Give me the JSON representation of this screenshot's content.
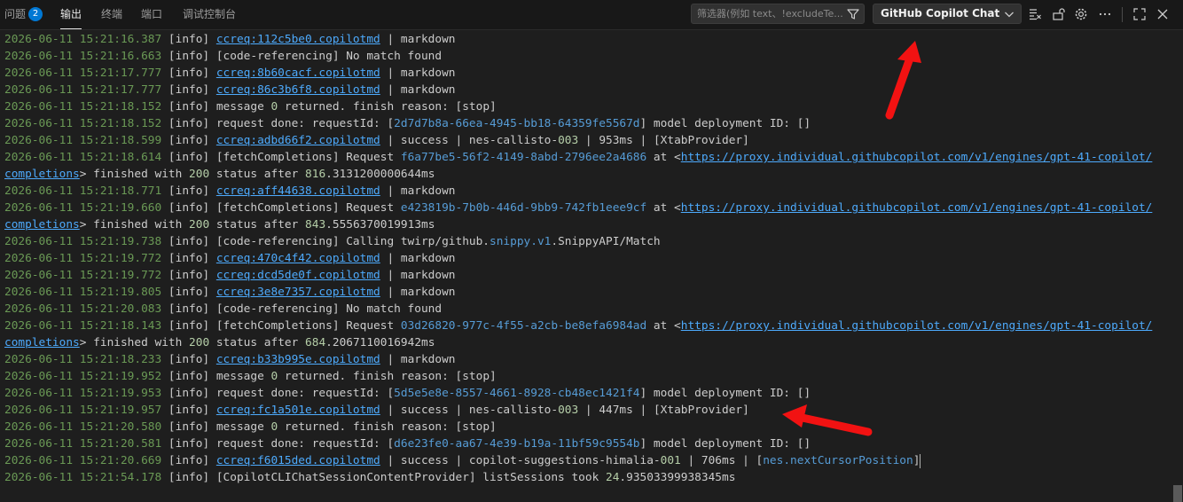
{
  "tabs": [
    {
      "label": "问题",
      "badge": "2"
    },
    {
      "label": "输出"
    },
    {
      "label": "终端"
    },
    {
      "label": "端口"
    },
    {
      "label": "调试控制台"
    }
  ],
  "filter": {
    "placeholder": "筛选器(例如 text、!excludeTe..."
  },
  "channel": {
    "selected": "GitHub Copilot Chat"
  },
  "toolbar_icons": [
    "filter-icon",
    "chevron-down-icon",
    "clear-output-icon",
    "lock-icon",
    "gear-icon",
    "more-icon",
    "maximize-icon",
    "close-icon"
  ],
  "colors": {
    "timestamp": "#6a9955",
    "number": "#b5cea8",
    "hash": "#569cd6",
    "link": "#4daafc",
    "arrow": "#f21212"
  },
  "log": [
    [
      [
        "ts",
        "2026-06-11 15:21:16.387"
      ],
      [
        "t",
        " [info] "
      ],
      [
        "lnk",
        "ccreq:112c5be0.copilotmd"
      ],
      [
        "t",
        " | markdown"
      ]
    ],
    [
      [
        "ts",
        "2026-06-11 15:21:16.663"
      ],
      [
        "t",
        " [info] [code-referencing] No match found"
      ]
    ],
    [
      [
        "ts",
        "2026-06-11 15:21:17.777"
      ],
      [
        "t",
        " [info] "
      ],
      [
        "lnk",
        "ccreq:8b60cacf.copilotmd"
      ],
      [
        "t",
        " | markdown"
      ]
    ],
    [
      [
        "ts",
        "2026-06-11 15:21:17.777"
      ],
      [
        "t",
        " [info] "
      ],
      [
        "lnk",
        "ccreq:86c3b6f8.copilotmd"
      ],
      [
        "t",
        " | markdown"
      ]
    ],
    [
      [
        "ts",
        "2026-06-11 15:21:18.152"
      ],
      [
        "t",
        " [info] message "
      ],
      [
        "num",
        "0"
      ],
      [
        "t",
        " returned. finish reason: [stop]"
      ]
    ],
    [
      [
        "ts",
        "2026-06-11 15:21:18.152"
      ],
      [
        "t",
        " [info] request done: requestId: ["
      ],
      [
        "hex",
        "2d7d7b8a-66ea-4945-bb18-64359fe5567d"
      ],
      [
        "t",
        "] model deployment ID: []"
      ]
    ],
    [
      [
        "ts",
        "2026-06-11 15:21:18.599"
      ],
      [
        "t",
        " [info] "
      ],
      [
        "lnk",
        "ccreq:adbd66f2.copilotmd"
      ],
      [
        "t",
        " | success | nes-callisto-"
      ],
      [
        "num",
        "003"
      ],
      [
        "t",
        " | 953ms | [XtabProvider]"
      ]
    ],
    [
      [
        "ts",
        "2026-06-11 15:21:18.614"
      ],
      [
        "t",
        " [info] [fetchCompletions] Request "
      ],
      [
        "hex",
        "f6a77be5-56f2-4149-8abd-2796ee2a4686"
      ],
      [
        "t",
        " at <"
      ],
      [
        "lnk",
        "https://proxy.individual.githubcopilot.com/v1/engines/gpt-41-copilot/"
      ]
    ],
    [
      [
        "lnk",
        "completions"
      ],
      [
        "t",
        "> finished with "
      ],
      [
        "num",
        "200"
      ],
      [
        "t",
        " status after "
      ],
      [
        "num",
        "816"
      ],
      [
        "t",
        ".3131200000644ms"
      ]
    ],
    [
      [
        "ts",
        "2026-06-11 15:21:18.771"
      ],
      [
        "t",
        " [info] "
      ],
      [
        "lnk",
        "ccreq:aff44638.copilotmd"
      ],
      [
        "t",
        " | markdown"
      ]
    ],
    [
      [
        "ts",
        "2026-06-11 15:21:19.660"
      ],
      [
        "t",
        " [info] [fetchCompletions] Request "
      ],
      [
        "hex",
        "e423819b-7b0b-446d-9bb9-742fb1eee9cf"
      ],
      [
        "t",
        " at <"
      ],
      [
        "lnk",
        "https://proxy.individual.githubcopilot.com/v1/engines/gpt-41-copilot/"
      ]
    ],
    [
      [
        "lnk",
        "completions"
      ],
      [
        "t",
        "> finished with "
      ],
      [
        "num",
        "200"
      ],
      [
        "t",
        " status after "
      ],
      [
        "num",
        "843"
      ],
      [
        "t",
        ".5556370019913ms"
      ]
    ],
    [
      [
        "ts",
        "2026-06-11 15:21:19.738"
      ],
      [
        "t",
        " [info] [code-referencing] Calling twirp/github."
      ],
      [
        "hex",
        "snippy.v1"
      ],
      [
        "t",
        ".SnippyAPI/Match"
      ]
    ],
    [
      [
        "ts",
        "2026-06-11 15:21:19.772"
      ],
      [
        "t",
        " [info] "
      ],
      [
        "lnk",
        "ccreq:470c4f42.copilotmd"
      ],
      [
        "t",
        " | markdown"
      ]
    ],
    [
      [
        "ts",
        "2026-06-11 15:21:19.772"
      ],
      [
        "t",
        " [info] "
      ],
      [
        "lnk",
        "ccreq:dcd5de0f.copilotmd"
      ],
      [
        "t",
        " | markdown"
      ]
    ],
    [
      [
        "ts",
        "2026-06-11 15:21:19.805"
      ],
      [
        "t",
        " [info] "
      ],
      [
        "lnk",
        "ccreq:3e8e7357.copilotmd"
      ],
      [
        "t",
        " | markdown"
      ]
    ],
    [
      [
        "ts",
        "2026-06-11 15:21:20.083"
      ],
      [
        "t",
        " [info] [code-referencing] No match found"
      ]
    ],
    [
      [
        "ts",
        "2026-06-11 15:21:18.143"
      ],
      [
        "t",
        " [info] [fetchCompletions] Request "
      ],
      [
        "hex",
        "03d26820-977c-4f55-a2cb-be8efa6984ad"
      ],
      [
        "t",
        " at <"
      ],
      [
        "lnk",
        "https://proxy.individual.githubcopilot.com/v1/engines/gpt-41-copilot/"
      ]
    ],
    [
      [
        "lnk",
        "completions"
      ],
      [
        "t",
        "> finished with "
      ],
      [
        "num",
        "200"
      ],
      [
        "t",
        " status after "
      ],
      [
        "num",
        "684"
      ],
      [
        "t",
        ".2067110016942ms"
      ]
    ],
    [
      [
        "ts",
        "2026-06-11 15:21:18.233"
      ],
      [
        "t",
        " [info] "
      ],
      [
        "lnk",
        "ccreq:b33b995e.copilotmd"
      ],
      [
        "t",
        " | markdown"
      ]
    ],
    [
      [
        "ts",
        "2026-06-11 15:21:19.952"
      ],
      [
        "t",
        " [info] message "
      ],
      [
        "num",
        "0"
      ],
      [
        "t",
        " returned. finish reason: [stop]"
      ]
    ],
    [
      [
        "ts",
        "2026-06-11 15:21:19.953"
      ],
      [
        "t",
        " [info] request done: requestId: ["
      ],
      [
        "hex",
        "5d5e5e8e-8557-4661-8928-cb48ec1421f4"
      ],
      [
        "t",
        "] model deployment ID: []"
      ]
    ],
    [
      [
        "ts",
        "2026-06-11 15:21:19.957"
      ],
      [
        "t",
        " [info] "
      ],
      [
        "lnk",
        "ccreq:fc1a501e.copilotmd"
      ],
      [
        "t",
        " | success | nes-callisto-"
      ],
      [
        "num",
        "003"
      ],
      [
        "t",
        " | 447ms | [XtabProvider]"
      ]
    ],
    [
      [
        "ts",
        "2026-06-11 15:21:20.580"
      ],
      [
        "t",
        " [info] message "
      ],
      [
        "num",
        "0"
      ],
      [
        "t",
        " returned. finish reason: [stop]"
      ]
    ],
    [
      [
        "ts",
        "2026-06-11 15:21:20.581"
      ],
      [
        "t",
        " [info] request done: requestId: ["
      ],
      [
        "hex",
        "d6e23fe0-aa67-4e39-b19a-11bf59c9554b"
      ],
      [
        "t",
        "] model deployment ID: []"
      ]
    ],
    [
      [
        "ts",
        "2026-06-11 15:21:20.669"
      ],
      [
        "t",
        " [info] "
      ],
      [
        "lnk",
        "ccreq:f6015ded.copilotmd"
      ],
      [
        "t",
        " | success | copilot-suggestions-himalia-"
      ],
      [
        "num",
        "001"
      ],
      [
        "t",
        " | 706ms | ["
      ],
      [
        "hex",
        "nes.nextCursorPosition"
      ],
      [
        "t",
        "]"
      ]
    ],
    [
      [
        "ts",
        "2026-06-11 15:21:54.178"
      ],
      [
        "t",
        " [info] [CopilotCLIChatSessionContentProvider] listSessions took "
      ],
      [
        "num",
        "24"
      ],
      [
        "t",
        ".93503399938345ms"
      ]
    ]
  ]
}
